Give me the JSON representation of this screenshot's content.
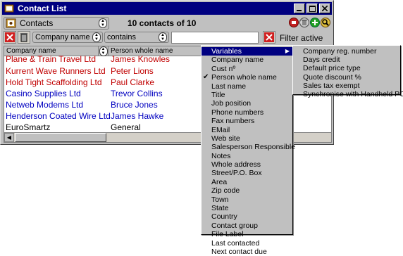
{
  "window": {
    "title": "Contact List",
    "controls": [
      "_",
      "□",
      "×"
    ]
  },
  "toolbar": {
    "database": "Contacts",
    "count_text": "10 contacts of 10"
  },
  "filter": {
    "field": "Company name",
    "operator": "contains",
    "value": "",
    "status": "Filter active"
  },
  "list": {
    "columns": [
      "Company name",
      "Person whole name"
    ],
    "rows": [
      {
        "company": "Plane & Train Travel Ltd",
        "person": "James Knowles",
        "color": "#c00000"
      },
      {
        "company": "Kurrent Wave Runners Ltd",
        "person": "Peter Lions",
        "color": "#c00000"
      },
      {
        "company": "Hold Tight Scaffolding Ltd",
        "person": "Paul Clarke",
        "color": "#c00000"
      },
      {
        "company": "Casino Supplies Ltd",
        "person": "Trevor Collins",
        "color": "#0000c0"
      },
      {
        "company": "Netweb Modems Ltd",
        "person": "Bruce Jones",
        "color": "#0000c0"
      },
      {
        "company": "Henderson Coated Wire Ltd",
        "person": "James Hawke",
        "color": "#0000c0"
      },
      {
        "company": "EuroSmartz",
        "person": "General",
        "color": "#000000"
      }
    ]
  },
  "menu": {
    "items": [
      {
        "label": "Variables",
        "selected": true,
        "submenu": true
      },
      {
        "label": "Company name"
      },
      {
        "label": "Cust nº"
      },
      {
        "label": "Person whole name",
        "checked": true
      },
      {
        "label": "Last name"
      },
      {
        "label": "Title"
      },
      {
        "label": "Job position"
      },
      {
        "label": "Phone numbers"
      },
      {
        "label": "Fax numbers"
      },
      {
        "label": "EMail"
      },
      {
        "label": "Web site"
      },
      {
        "label": "Salesperson Responsible"
      },
      {
        "label": "Notes"
      },
      {
        "label": "Whole address"
      },
      {
        "label": "Street/P.O. Box"
      },
      {
        "label": "Area"
      },
      {
        "label": "Zip code"
      },
      {
        "label": "Town"
      },
      {
        "label": "State"
      },
      {
        "label": "Country"
      },
      {
        "label": "Contact group"
      },
      {
        "label": "File Label"
      },
      {
        "label": "Last contacted"
      },
      {
        "label": "Next contact due"
      }
    ]
  },
  "submenu": {
    "items": [
      "Company reg. number",
      "Days credit",
      "Default price type",
      "Quote discount %",
      "Sales tax exempt",
      "Synchronise with Handheld PC"
    ]
  },
  "icons": {
    "title": "address-book-icon",
    "database": "address-book-icon",
    "clear_filter": "red-x-icon",
    "trash": "trash-icon",
    "print": "print-icon",
    "add": "green-plus-icon",
    "search": "magnifier-icon"
  }
}
